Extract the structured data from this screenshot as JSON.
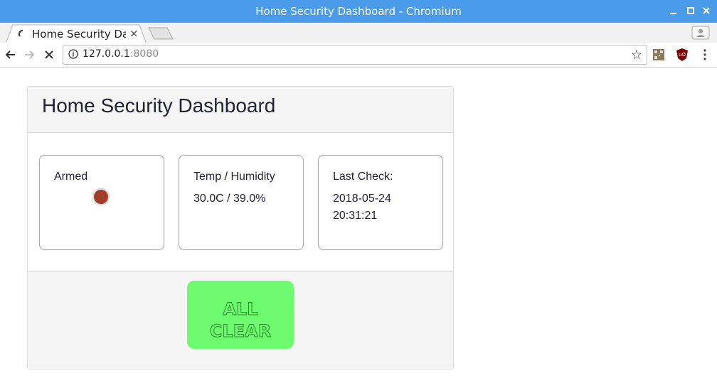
{
  "window": {
    "title": "Home Security Dashboard - Chromium"
  },
  "tab": {
    "title": "Home Security Da",
    "close_label": "×"
  },
  "omnibox": {
    "host": "127.0.0.1",
    "port": ":8080"
  },
  "dashboard": {
    "title": "Home Security Dashboard",
    "cards": [
      {
        "label": "Armed",
        "status_color": "#a23d2a"
      },
      {
        "label": "Temp / Humidity",
        "value": "30.0C / 39.0%"
      },
      {
        "label": "Last Check:",
        "date": "2018-05-24",
        "time": "20:31:21"
      }
    ],
    "all_clear": {
      "line1": "ALL",
      "line2": "CLEAR",
      "color": "#6ffb6f"
    }
  },
  "colors": {
    "titlebar": "#4a9bea",
    "text": "#222233"
  }
}
